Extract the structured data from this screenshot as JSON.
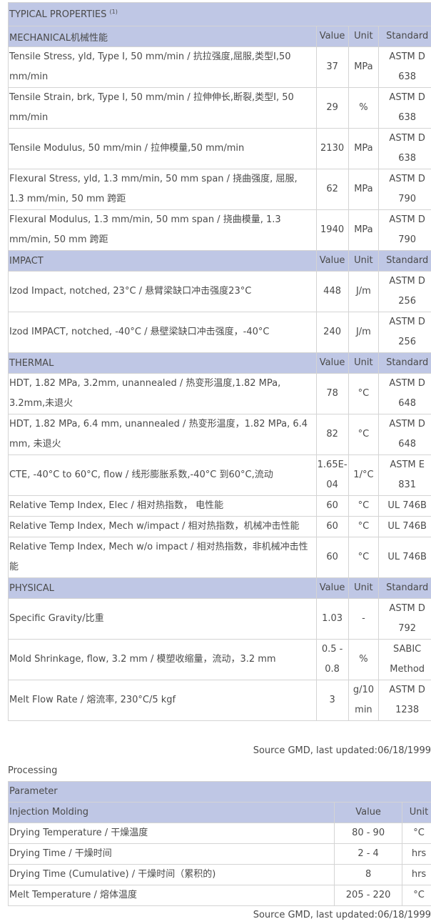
{
  "typical": {
    "title": "TYPICAL PROPERTIES",
    "title_sup": "(1)",
    "sections": [
      {
        "name": "MECHANICAL机械性能",
        "h_value": "Value",
        "h_unit": "Unit",
        "h_standard": "Standard",
        "rows": [
          {
            "property": "Tensile Stress, yld, Type I, 50 mm/min / 抗拉强度,屈服,类型I,50 mm/min",
            "value": "37",
            "unit": "MPa",
            "standard": "ASTM D 638"
          },
          {
            "property": "Tensile Strain, brk, Type I, 50 mm/min / 拉伸伸长,断裂,类型I, 50 mm/min",
            "value": "29",
            "unit": "%",
            "standard": "ASTM D 638"
          },
          {
            "property": "Tensile Modulus, 50 mm/min / 拉伸模量,50 mm/min",
            "value": "2130",
            "unit": "MPa",
            "standard": "ASTM D 638"
          },
          {
            "property": "Flexural Stress, yld, 1.3 mm/min, 50 mm span / 挠曲强度, 屈服, 1.3 mm/min, 50 mm 跨距",
            "value": "62",
            "unit": "MPa",
            "standard": "ASTM D 790"
          },
          {
            "property": "Flexural Modulus, 1.3 mm/min, 50 mm span / 挠曲模量, 1.3 mm/min, 50 mm 跨距",
            "value": "1940",
            "unit": "MPa",
            "standard": "ASTM D 790"
          }
        ]
      },
      {
        "name": "IMPACT",
        "h_value": "Value",
        "h_unit": "Unit",
        "h_standard": "Standard",
        "rows": [
          {
            "property": "Izod Impact, notched, 23°C / 悬臂梁缺口冲击强度23°C",
            "value": "448",
            "unit": "J/m",
            "standard": "ASTM D 256"
          },
          {
            "property": "Izod IMPACT, notched, -40°C / 悬壁梁缺口冲击强度，-40°C",
            "value": "240",
            "unit": "J/m",
            "standard": "ASTM D 256"
          }
        ]
      },
      {
        "name": "THERMAL",
        "h_value": "Value",
        "h_unit": "Unit",
        "h_standard": "Standard",
        "rows": [
          {
            "property": "HDT, 1.82 MPa, 3.2mm, unannealed / 热变形温度,1.82 MPa, 3.2mm,未退火",
            "value": "78",
            "unit": "°C",
            "standard": "ASTM D 648"
          },
          {
            "property": "HDT, 1.82 MPa, 6.4 mm, unannealed / 热变形温度，1.82 MPa, 6.4 mm, 未退火",
            "value": "82",
            "unit": "°C",
            "standard": "ASTM D 648"
          },
          {
            "property": "CTE, -40°C to 60°C, flow / 线形膨胀系数,-40°C 到60°C,流动",
            "value": "1.65E-04",
            "unit": "1/°C",
            "standard": "ASTM E 831"
          },
          {
            "property": "Relative Temp Index, Elec / 相对热指数， 电性能",
            "value": "60",
            "unit": "°C",
            "standard": "UL 746B"
          },
          {
            "property": "Relative Temp Index, Mech w/impact / 相对热指数，机械冲击性能",
            "value": "60",
            "unit": "°C",
            "standard": "UL 746B"
          },
          {
            "property": "Relative Temp Index, Mech w/o impact / 相对热指数，非机械冲击性能",
            "value": "60",
            "unit": "°C",
            "standard": "UL 746B"
          }
        ]
      },
      {
        "name": "PHYSICAL",
        "h_value": "Value",
        "h_unit": "Unit",
        "h_standard": "Standard",
        "rows": [
          {
            "property": "Specific Gravity/比重",
            "value": "1.03",
            "unit": "-",
            "standard": "ASTM D 792"
          },
          {
            "property": "Mold Shrinkage, flow, 3.2 mm / 模塑收缩量，流动，3.2 mm",
            "value": "0.5 - 0.8",
            "unit": "%",
            "standard": "SABIC Method"
          },
          {
            "property": "Melt Flow Rate / 熔流率, 230°C/5 kgf",
            "value": "3",
            "unit": "g/10 min",
            "standard": "ASTM D 1238"
          }
        ]
      }
    ],
    "source": "Source GMD, last updated:06/18/1999"
  },
  "processing": {
    "label": "Processing",
    "title": "Parameter",
    "section": "Injection Molding",
    "h_value": "Value",
    "h_unit": "Unit",
    "rows": [
      {
        "parameter": "Drying Temperature / 干燥温度",
        "value": "80 - 90",
        "unit": "°C"
      },
      {
        "parameter": "Drying Time / 干燥时间",
        "value": "2 - 4",
        "unit": "hrs"
      },
      {
        "parameter": "Drying Time (Cumulative) / 干燥时间（累积的)",
        "value": "8",
        "unit": "hrs"
      },
      {
        "parameter": "Melt Temperature / 熔体温度",
        "value": "205 - 220",
        "unit": "°C"
      }
    ],
    "source": "Source GMD, last updated:06/18/1999"
  }
}
